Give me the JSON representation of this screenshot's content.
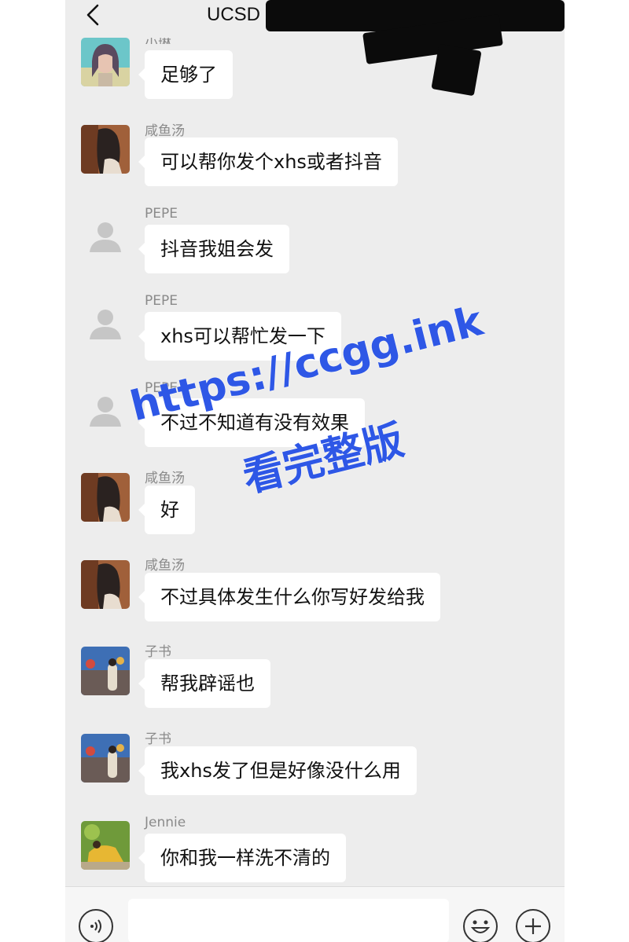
{
  "header": {
    "title": "UCSD",
    "back_icon": "chevron-left-icon"
  },
  "messages": [
    {
      "name": "小琳",
      "text": "足够了",
      "avatar": "photo-avatar-1"
    },
    {
      "name": "咸鱼汤",
      "text": "可以帮你发个xhs或者抖音",
      "avatar": "photo-avatar-2"
    },
    {
      "name": "PEPE",
      "text": "抖音我姐会发",
      "avatar": "default-avatar-icon"
    },
    {
      "name": "PEPE",
      "text": "xhs可以帮忙发一下",
      "avatar": "default-avatar-icon"
    },
    {
      "name": "PEPE",
      "text": "不过不知道有没有效果",
      "avatar": "default-avatar-icon"
    },
    {
      "name": "咸鱼汤",
      "text": "好",
      "avatar": "photo-avatar-2"
    },
    {
      "name": "咸鱼汤",
      "text": "不过具体发生什么你写好发给我",
      "avatar": "photo-avatar-2"
    },
    {
      "name": "子书",
      "text": "帮我辟谣也",
      "avatar": "photo-avatar-3"
    },
    {
      "name": "子书",
      "text": "我xhs发了但是好像没什么用",
      "avatar": "photo-avatar-3"
    },
    {
      "name": "Jennie",
      "text": "你和我一样洗不清的",
      "avatar": "photo-avatar-4"
    }
  ],
  "watermark": {
    "line1": "https://ccgg.ink",
    "line2": "看完整版"
  },
  "bottom_bar": {
    "voice_icon": "voice-icon",
    "emoji_icon": "emoji-icon",
    "plus_icon": "plus-icon"
  },
  "colors": {
    "background": "#ededed",
    "bubble": "#ffffff",
    "watermark": "#2e57e6"
  }
}
